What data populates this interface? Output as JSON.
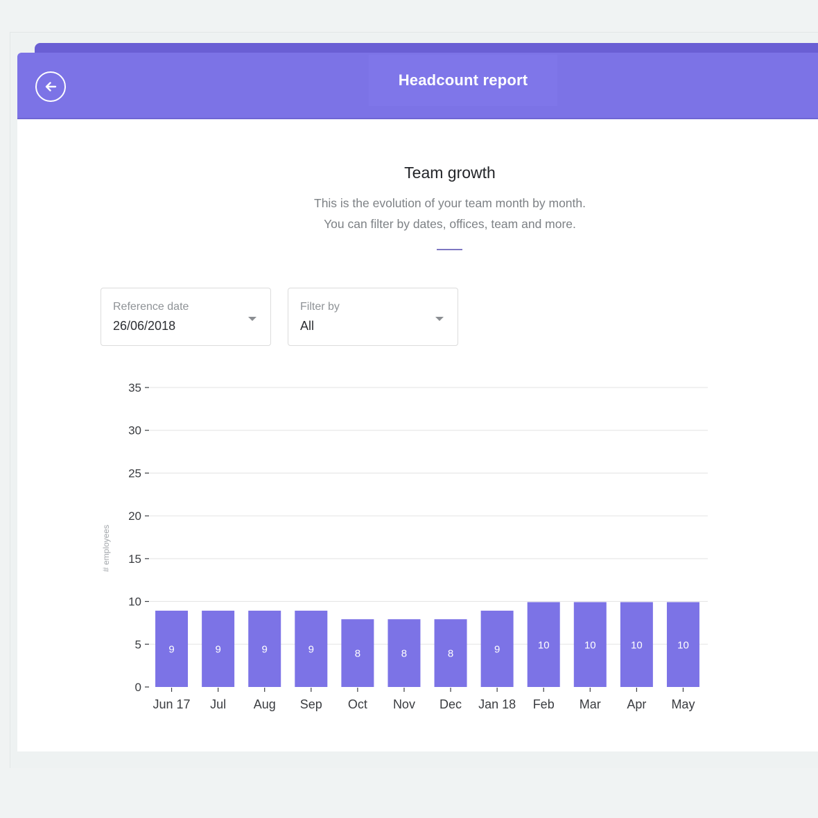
{
  "header": {
    "title": "Headcount report"
  },
  "section": {
    "title": "Team growth",
    "description_line1": "This is the evolution of your team month by month.",
    "description_line2": "You can filter by dates, offices, team and more."
  },
  "filters": {
    "reference_date": {
      "label": "Reference date",
      "value": "26/06/2018"
    },
    "filter_by": {
      "label": "Filter by",
      "value": "All"
    }
  },
  "colors": {
    "accent": "#7c73e6",
    "bar": "#7c73e6",
    "bar_label": "#ffffff",
    "grid": "#e3e3e3",
    "axis_text": "#3a3c40"
  },
  "icons": {
    "back": "arrow-left-circle-icon",
    "dropdown": "caret-down-icon"
  },
  "chart_data": {
    "type": "bar",
    "categories": [
      "Jun 17",
      "Jul",
      "Aug",
      "Sep",
      "Oct",
      "Nov",
      "Dec",
      "Jan 18",
      "Feb",
      "Mar",
      "Apr",
      "May"
    ],
    "values": [
      9,
      9,
      9,
      9,
      8,
      8,
      8,
      9,
      10,
      10,
      10,
      10
    ],
    "ylabel": "# employees",
    "ylim": [
      0,
      35
    ],
    "yticks": [
      0,
      5,
      10,
      15,
      20,
      25,
      30,
      35
    ],
    "grid": true,
    "data_labels": true
  }
}
